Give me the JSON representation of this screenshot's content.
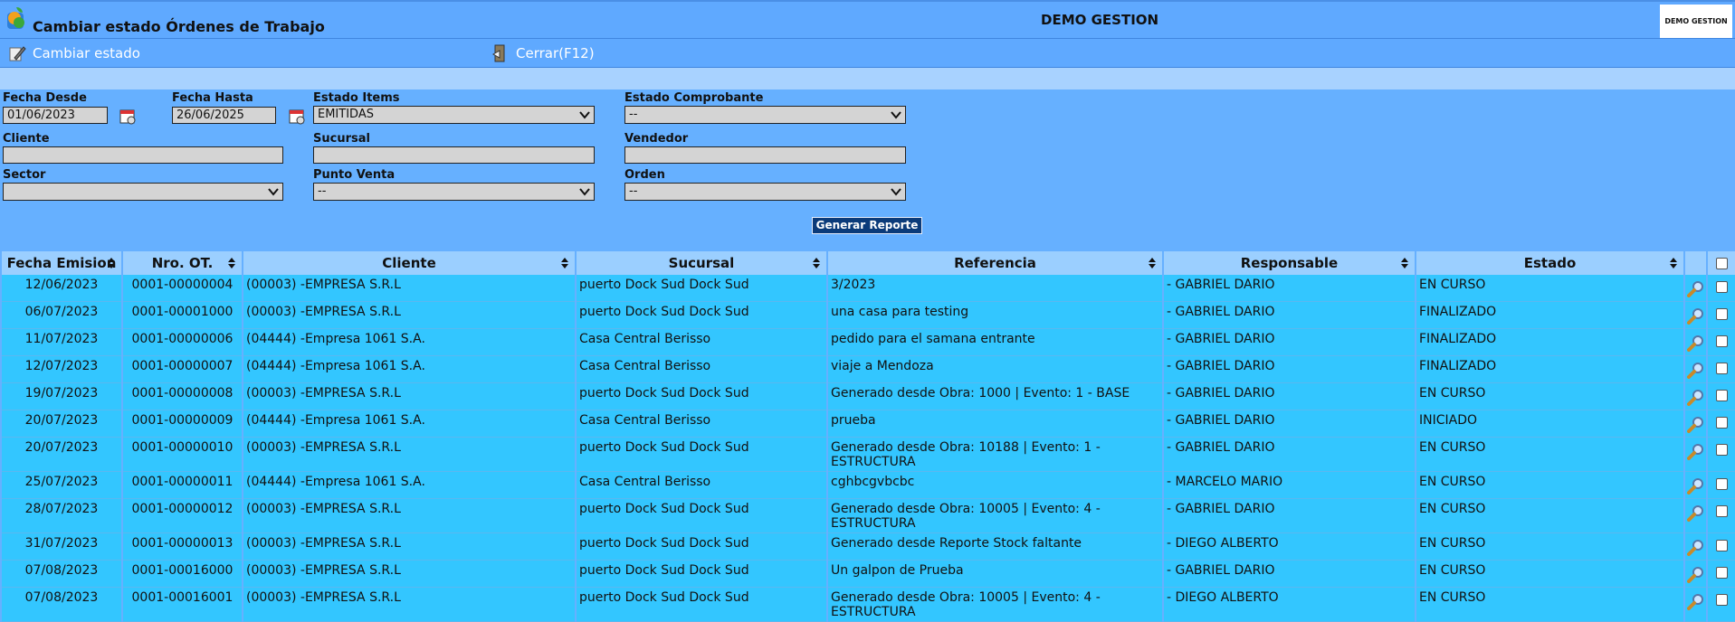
{
  "header": {
    "title": "Cambiar estado Órdenes de Trabajo",
    "company": "DEMO GESTION",
    "company_logo_text": "DEMO GESTION"
  },
  "toolbar": {
    "change_state_label": "Cambiar estado",
    "close_label": "Cerrar(F12)"
  },
  "filters": {
    "fecha_desde": {
      "label": "Fecha Desde",
      "value": "01/06/2023"
    },
    "fecha_hasta": {
      "label": "Fecha Hasta",
      "value": "26/06/2025"
    },
    "estado_items": {
      "label": "Estado Items",
      "value": "EMITIDAS"
    },
    "estado_comprobante": {
      "label": "Estado Comprobante",
      "value": "--"
    },
    "cliente": {
      "label": "Cliente",
      "value": ""
    },
    "sucursal": {
      "label": "Sucursal",
      "value": ""
    },
    "vendedor": {
      "label": "Vendedor",
      "value": ""
    },
    "sector": {
      "label": "Sector",
      "value": ""
    },
    "punto_venta": {
      "label": "Punto Venta",
      "value": "--"
    },
    "orden": {
      "label": "Orden",
      "value": "--"
    },
    "generate_label": "Generar Reporte"
  },
  "table": {
    "columns": [
      "Fecha Emision",
      "Nro. OT.",
      "Cliente",
      "Sucursal",
      "Referencia",
      "Responsable",
      "Estado"
    ],
    "rows": [
      {
        "fecha": "12/06/2023",
        "nro": "0001-00000004",
        "cliente": "(00003) -EMPRESA S.R.L",
        "sucursal": "puerto Dock Sud Dock Sud",
        "referencia": "3/2023",
        "responsable": "- GABRIEL DARIO",
        "estado": "EN CURSO",
        "tall": false
      },
      {
        "fecha": "06/07/2023",
        "nro": "0001-00001000",
        "cliente": "(00003) -EMPRESA S.R.L",
        "sucursal": "puerto Dock Sud Dock Sud",
        "referencia": "una casa para testing",
        "responsable": "- GABRIEL DARIO",
        "estado": "FINALIZADO",
        "tall": false
      },
      {
        "fecha": "11/07/2023",
        "nro": "0001-00000006",
        "cliente": "(04444) -Empresa 1061 S.A.",
        "sucursal": "Casa Central Berisso",
        "referencia": "pedido para el samana entrante",
        "responsable": "- GABRIEL DARIO",
        "estado": "FINALIZADO",
        "tall": false
      },
      {
        "fecha": "12/07/2023",
        "nro": "0001-00000007",
        "cliente": "(04444) -Empresa 1061 S.A.",
        "sucursal": "Casa Central Berisso",
        "referencia": "viaje a Mendoza",
        "responsable": "- GABRIEL DARIO",
        "estado": "FINALIZADO",
        "tall": false
      },
      {
        "fecha": "19/07/2023",
        "nro": "0001-00000008",
        "cliente": "(00003) -EMPRESA S.R.L",
        "sucursal": "puerto Dock Sud Dock Sud",
        "referencia": "Generado desde Obra: 1000 | Evento: 1 - BASE",
        "responsable": "- GABRIEL DARIO",
        "estado": "EN CURSO",
        "tall": false
      },
      {
        "fecha": "20/07/2023",
        "nro": "0001-00000009",
        "cliente": "(04444) -Empresa 1061 S.A.",
        "sucursal": "Casa Central Berisso",
        "referencia": "prueba",
        "responsable": "- GABRIEL DARIO",
        "estado": "INICIADO",
        "tall": false
      },
      {
        "fecha": "20/07/2023",
        "nro": "0001-00000010",
        "cliente": "(00003) -EMPRESA S.R.L",
        "sucursal": "puerto Dock Sud Dock Sud",
        "referencia": "Generado desde Obra: 10188 | Evento: 1 - ESTRUCTURA",
        "responsable": "- GABRIEL DARIO",
        "estado": "EN CURSO",
        "tall": true
      },
      {
        "fecha": "25/07/2023",
        "nro": "0001-00000011",
        "cliente": "(04444) -Empresa 1061 S.A.",
        "sucursal": "Casa Central Berisso",
        "referencia": "cghbcgvbcbc",
        "responsable": "- MARCELO MARIO",
        "estado": "EN CURSO",
        "tall": false
      },
      {
        "fecha": "28/07/2023",
        "nro": "0001-00000012",
        "cliente": "(00003) -EMPRESA S.R.L",
        "sucursal": "puerto Dock Sud Dock Sud",
        "referencia": "Generado desde Obra: 10005 | Evento: 4 - ESTRUCTURA",
        "responsable": "- GABRIEL DARIO",
        "estado": "EN CURSO",
        "tall": true
      },
      {
        "fecha": "31/07/2023",
        "nro": "0001-00000013",
        "cliente": "(00003) -EMPRESA S.R.L",
        "sucursal": "puerto Dock Sud Dock Sud",
        "referencia": "Generado desde Reporte Stock faltante",
        "responsable": "- DIEGO ALBERTO",
        "estado": "EN CURSO",
        "tall": false
      },
      {
        "fecha": "07/08/2023",
        "nro": "0001-00016000",
        "cliente": "(00003) -EMPRESA S.R.L",
        "sucursal": "puerto Dock Sud Dock Sud",
        "referencia": "Un galpon de Prueba",
        "responsable": "- GABRIEL DARIO",
        "estado": "EN CURSO",
        "tall": false
      },
      {
        "fecha": "07/08/2023",
        "nro": "0001-00016001",
        "cliente": "(00003) -EMPRESA S.R.L",
        "sucursal": "puerto Dock Sud Dock Sud",
        "referencia": "Generado desde Obra: 10005 | Evento: 4 - ESTRUCTURA",
        "responsable": "- DIEGO ALBERTO",
        "estado": "EN CURSO",
        "tall": true
      }
    ]
  },
  "colors": {
    "background": "#66b0ff",
    "header_row": "#9bcfff",
    "data_row": "#33c6ff",
    "button": "#0b3b7a"
  }
}
